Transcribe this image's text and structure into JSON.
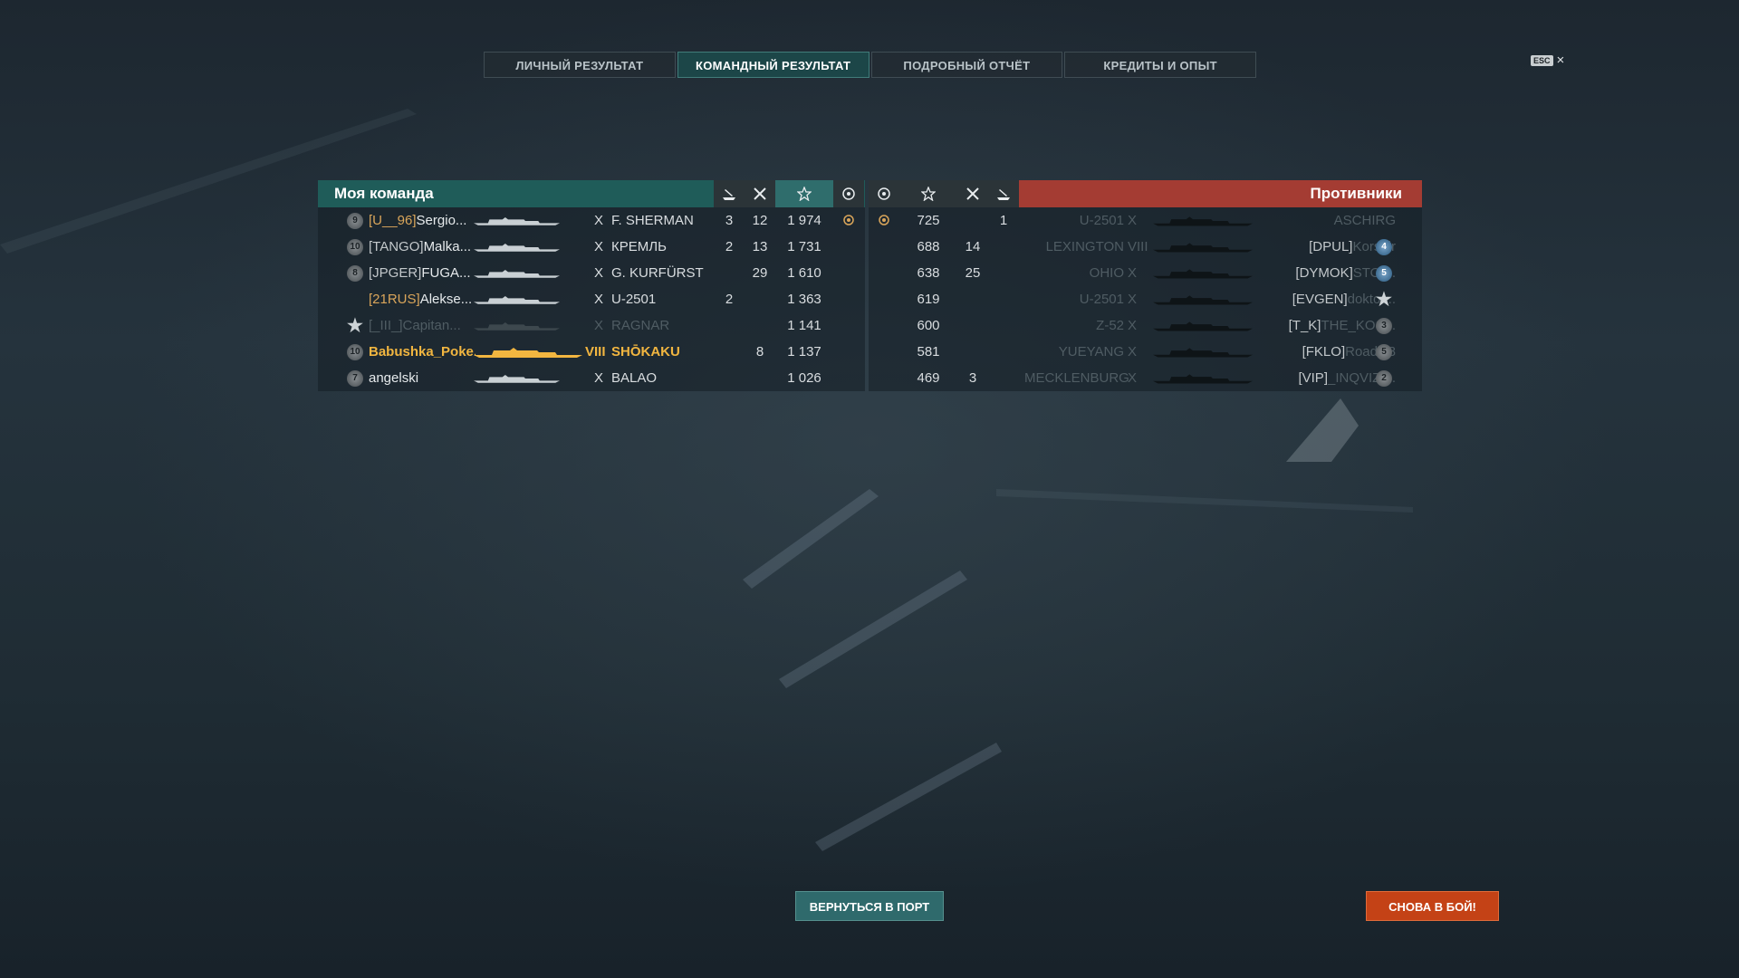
{
  "tabs": [
    {
      "label": "ЛИЧНЫЙ РЕЗУЛЬТАТ",
      "active": false
    },
    {
      "label": "КОМАНДНЫЙ РЕЗУЛЬТАТ",
      "active": true
    },
    {
      "label": "ПОДРОБНЫЙ ОТЧЁТ",
      "active": false
    },
    {
      "label": "КРЕДИТЫ И ОПЫТ",
      "active": false
    }
  ],
  "esc": {
    "key": "ESC",
    "close": "×"
  },
  "my_team": {
    "title": "Моя команда",
    "header_icons": [
      "ship-hit-icon",
      "crossed-swords-icon",
      "star-icon",
      "laurel-icon"
    ],
    "rows": [
      {
        "level": "9",
        "level_style": "gray",
        "clan": "[U__96]",
        "clan_gold": true,
        "player": "Sergio...",
        "tier": "X",
        "ship": "F. SHERMAN",
        "col1": "3",
        "col2": "12",
        "exp": "1 974",
        "medal": true,
        "dim": false,
        "me": false
      },
      {
        "level": "10",
        "level_style": "gray",
        "clan": "[TANGO]",
        "clan_gold": false,
        "player": "Malka...",
        "tier": "X",
        "ship": "КРЕМЛЬ",
        "col1": "2",
        "col2": "13",
        "exp": "1 731",
        "medal": false,
        "dim": false,
        "me": false
      },
      {
        "level": "8",
        "level_style": "gray",
        "clan": "[JPGER]",
        "clan_gold": false,
        "player": "FUGA...",
        "tier": "X",
        "ship": "G. KURFÜRST",
        "col1": "",
        "col2": "29",
        "exp": "1 610",
        "medal": false,
        "dim": false,
        "me": false
      },
      {
        "level": "",
        "level_style": "none",
        "clan": "[21RUS]",
        "clan_gold": true,
        "player": "Alekse...",
        "tier": "X",
        "ship": "U-2501",
        "col1": "2",
        "col2": "",
        "exp": "1 363",
        "medal": false,
        "dim": false,
        "me": false
      },
      {
        "level": "★",
        "level_style": "rank",
        "clan": "[_III_]",
        "clan_gold": false,
        "player": "Capitan...",
        "tier": "X",
        "ship": "RAGNAR",
        "col1": "",
        "col2": "",
        "exp": "1 141",
        "medal": false,
        "dim": true,
        "me": false
      },
      {
        "level": "10",
        "level_style": "gray",
        "clan": "",
        "clan_gold": false,
        "player": "Babushka_Poke...",
        "tier": "VIII",
        "ship": "SHŌKAKU",
        "col1": "",
        "col2": "8",
        "exp": "1 137",
        "medal": false,
        "dim": false,
        "me": true
      },
      {
        "level": "7",
        "level_style": "gray",
        "clan": "",
        "clan_gold": false,
        "player": "angelski",
        "tier": "X",
        "ship": "BALAO",
        "col1": "",
        "col2": "",
        "exp": "1 026",
        "medal": false,
        "dim": false,
        "me": false
      }
    ]
  },
  "enemies": {
    "title": "Противники",
    "header_icons": [
      "laurel-icon",
      "star-icon",
      "crossed-swords-icon",
      "ship-hit-icon"
    ],
    "rows": [
      {
        "medal": true,
        "exp": "725",
        "col2": "",
        "col1": "1",
        "ship": "U-2501",
        "tier": "X",
        "clan": "",
        "player": "ASCHIRG",
        "level": "",
        "level_style": "none",
        "dim": true
      },
      {
        "medal": false,
        "exp": "688",
        "col2": "14",
        "col1": "",
        "ship": "LEXINGTON",
        "tier": "VIII",
        "clan": "[DPUL]",
        "player": "Korsair",
        "level": "4",
        "level_style": "blue",
        "dim": true
      },
      {
        "medal": false,
        "exp": "638",
        "col2": "25",
        "col1": "",
        "ship": "OHIO",
        "tier": "X",
        "clan": "[DYMOK]",
        "player": "STOI...",
        "level": "5",
        "level_style": "blue",
        "dim": true
      },
      {
        "medal": false,
        "exp": "619",
        "col2": "",
        "col1": "",
        "ship": "U-2501",
        "tier": "X",
        "clan": "[EVGEN]",
        "player": "doktor...",
        "level": "★",
        "level_style": "rank",
        "dim": true
      },
      {
        "medal": false,
        "exp": "600",
        "col2": "",
        "col1": "",
        "ship": "Z-52",
        "tier": "X",
        "clan": "[T_K]",
        "player": "THE_KOS...",
        "level": "3",
        "level_style": "gray",
        "dim": true
      },
      {
        "medal": false,
        "exp": "581",
        "col2": "",
        "col1": "",
        "ship": "YUEYANG",
        "tier": "X",
        "clan": "[FKLO]",
        "player": "Roadie8",
        "level": "5",
        "level_style": "gray",
        "dim": true
      },
      {
        "medal": false,
        "exp": "469",
        "col2": "3",
        "col1": "",
        "ship": "MECKLENBURG",
        "tier": "X",
        "clan": "[VIP]",
        "player": "_INQVIZI...",
        "level": "2",
        "level_style": "gray",
        "dim": true
      }
    ]
  },
  "buttons": {
    "port": "ВЕРНУТЬСЯ В ПОРТ",
    "battle": "СНОВА В БОЙ!"
  },
  "colors": {
    "team_header": "#1f5c59",
    "enemy_header": "#a43c33",
    "me_highlight": "#f2b640",
    "battle_button": "#c44216"
  }
}
